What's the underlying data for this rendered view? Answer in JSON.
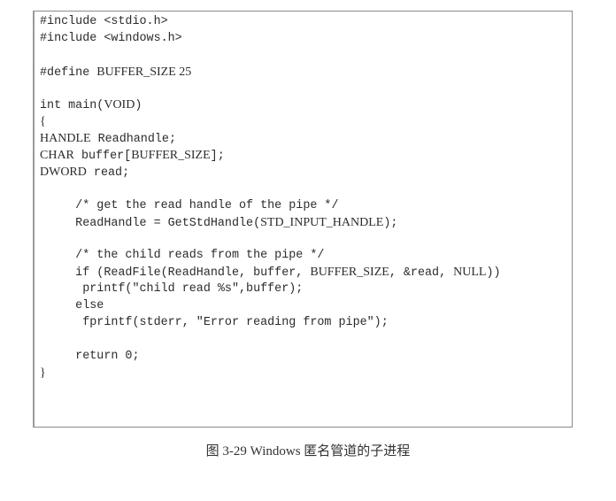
{
  "code_lines": [
    [
      [
        "#include <stdio.h>",
        0
      ]
    ],
    [
      [
        "#include <windows.h>",
        0
      ]
    ],
    [
      [
        "",
        0
      ]
    ],
    [
      [
        "#define ",
        0
      ],
      [
        "BUFFER_SIZE 25",
        1
      ]
    ],
    [
      [
        "",
        0
      ]
    ],
    [
      [
        "int main(",
        0
      ],
      [
        "VOID",
        1
      ],
      [
        ")",
        0
      ]
    ],
    [
      [
        "{",
        1
      ]
    ],
    [
      [
        "HANDLE",
        1
      ],
      [
        " Readhandle;",
        0
      ]
    ],
    [
      [
        "CHAR",
        1
      ],
      [
        " buffer[",
        0
      ],
      [
        "BUFFER_SIZE",
        1
      ],
      [
        "];",
        0
      ]
    ],
    [
      [
        "DWORD",
        1
      ],
      [
        " read;",
        0
      ]
    ],
    [
      [
        "",
        0
      ]
    ],
    [
      [
        "     /* get the read handle of the pipe */",
        0
      ]
    ],
    [
      [
        "     ReadHandle = GetStdHandle(",
        0
      ],
      [
        "STD_INPUT_HANDLE",
        1
      ],
      [
        ");",
        0
      ]
    ],
    [
      [
        "",
        0
      ]
    ],
    [
      [
        "     /* the child reads from the pipe */",
        0
      ]
    ],
    [
      [
        "     if (ReadFile(ReadHandle, buffer, ",
        0
      ],
      [
        "BUFFER_SIZE",
        1
      ],
      [
        ", &read, ",
        0
      ],
      [
        "NULL",
        1
      ],
      [
        "))",
        0
      ]
    ],
    [
      [
        "      printf(\"child read %s\",buffer);",
        0
      ]
    ],
    [
      [
        "     else",
        0
      ]
    ],
    [
      [
        "      fprintf(stderr, \"Error reading from pipe\");",
        0
      ]
    ],
    [
      [
        "",
        0
      ]
    ],
    [
      [
        "     return 0;",
        0
      ]
    ],
    [
      [
        "}",
        1
      ]
    ]
  ],
  "caption": "图 3-29   Windows 匿名管道的子进程"
}
